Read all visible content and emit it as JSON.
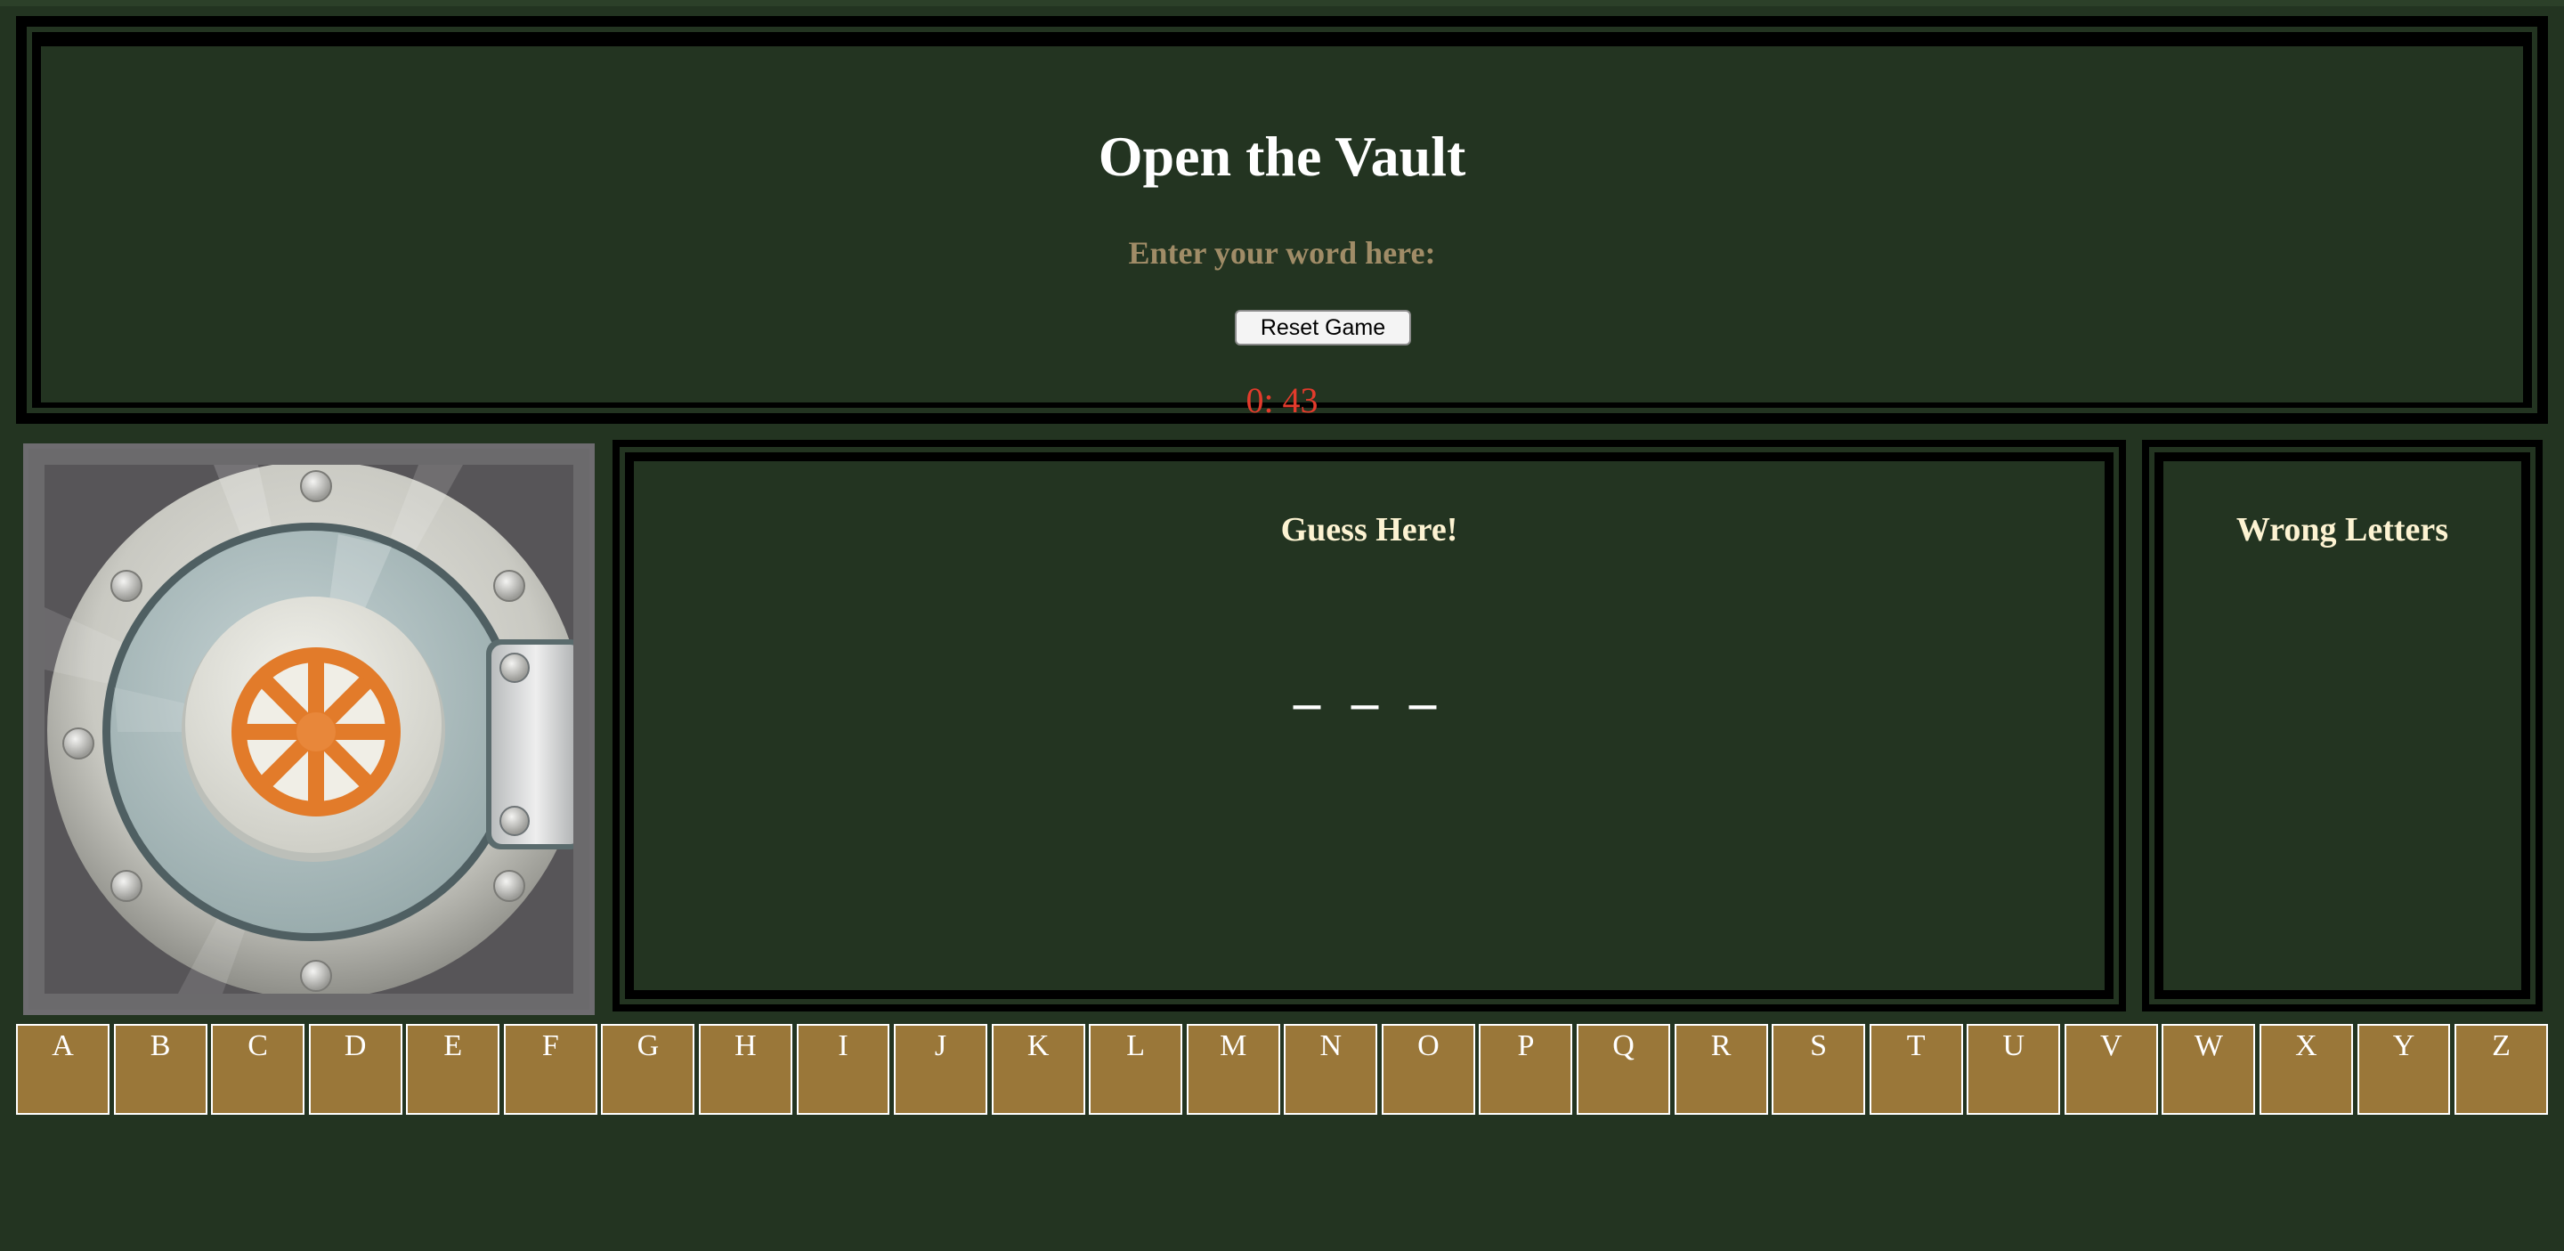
{
  "header": {
    "title": "Open the Vault",
    "prompt": "Enter your word here:",
    "reset_label": "Reset Game",
    "timer": "0: 43"
  },
  "vault": {
    "icon": "vault-door-icon"
  },
  "guess_panel": {
    "heading": "Guess Here!",
    "blanks": "_ _ _"
  },
  "wrong_panel": {
    "heading": "Wrong Letters"
  },
  "alphabet": [
    "A",
    "B",
    "C",
    "D",
    "E",
    "F",
    "G",
    "H",
    "I",
    "J",
    "K",
    "L",
    "M",
    "N",
    "O",
    "P",
    "Q",
    "R",
    "S",
    "T",
    "U",
    "V",
    "W",
    "X",
    "Y",
    "Z"
  ],
  "colors": {
    "background": "#233421",
    "title": "#ffffff",
    "prompt": "#a08c67",
    "timer": "#e33b2c",
    "heading": "#fdf3d2",
    "letter_tile": "#9a7739",
    "vault_accent": "#e27b2a"
  }
}
